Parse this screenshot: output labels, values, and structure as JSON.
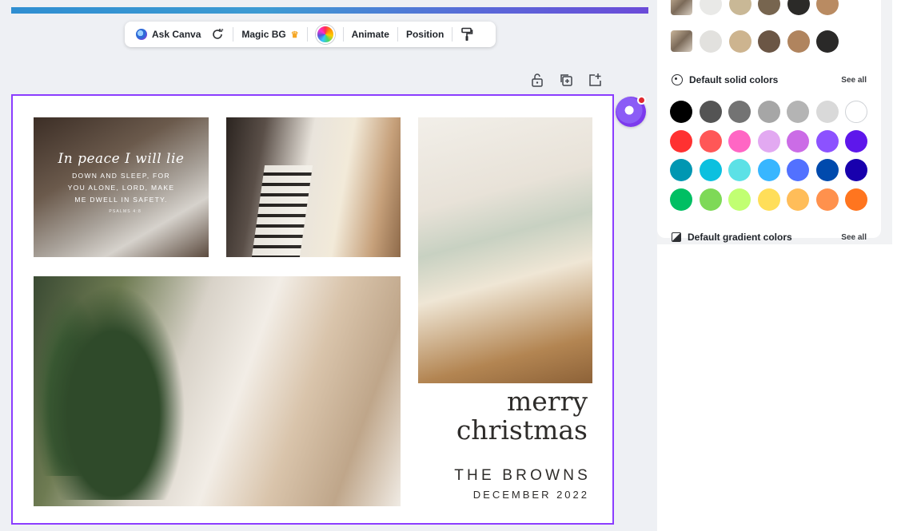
{
  "toolbar": {
    "ask_canva": "Ask Canva",
    "magic_bg": "Magic BG",
    "animate": "Animate",
    "position": "Position"
  },
  "design": {
    "quote_title": "In peace I will lie",
    "quote_line1": "DOWN AND SLEEP, FOR",
    "quote_line2": "YOU ALONE, LORD, MAKE",
    "quote_line3": "ME DWELL IN SAFETY.",
    "quote_ref": "PSALMS 4:8",
    "merry": "merry",
    "christmas": "christmas",
    "family_name": "THE BROWNS",
    "date": "DECEMBER 2022"
  },
  "color_panel": {
    "photo_colors_row1": [
      "#e9e9e7",
      "#c9b896",
      "#77654f",
      "#2b2a28",
      "#b98b62"
    ],
    "photo_colors_row2": [
      "#e2e1de",
      "#cdb48f",
      "#6b5645",
      "#b0845e",
      "#2a2928"
    ],
    "default_solid_title": "Default solid colors",
    "see_all": "See all",
    "solid_colors": [
      [
        "#000000",
        "#545454",
        "#737373",
        "#a6a6a6",
        "#b4b4b4",
        "#d9d9d9",
        "#ffffff"
      ],
      [
        "#ff3131",
        "#ff5757",
        "#ff66c4",
        "#e2a9f1",
        "#cb6ce6",
        "#8c52ff",
        "#5e17eb"
      ],
      [
        "#0097b2",
        "#0cc0df",
        "#5ce1e6",
        "#38b6ff",
        "#5271ff",
        "#004aad",
        "#1800ad"
      ],
      [
        "#00bf63",
        "#7ed957",
        "#c1ff72",
        "#ffde59",
        "#ffbd59",
        "#ff914d",
        "#ff751f"
      ]
    ],
    "default_gradient_title": "Default gradient colors",
    "see_all_2": "See all"
  },
  "colors": {
    "accent": "#8b3dff",
    "assistant_badge": "#e0282e"
  },
  "icons": {
    "regenerate": "sparkle-refresh-icon",
    "crown": "crown-icon",
    "paint_roller": "paint-roller-icon",
    "lock": "unlock-icon",
    "duplicate": "duplicate-icon",
    "add_page": "add-page-icon"
  }
}
